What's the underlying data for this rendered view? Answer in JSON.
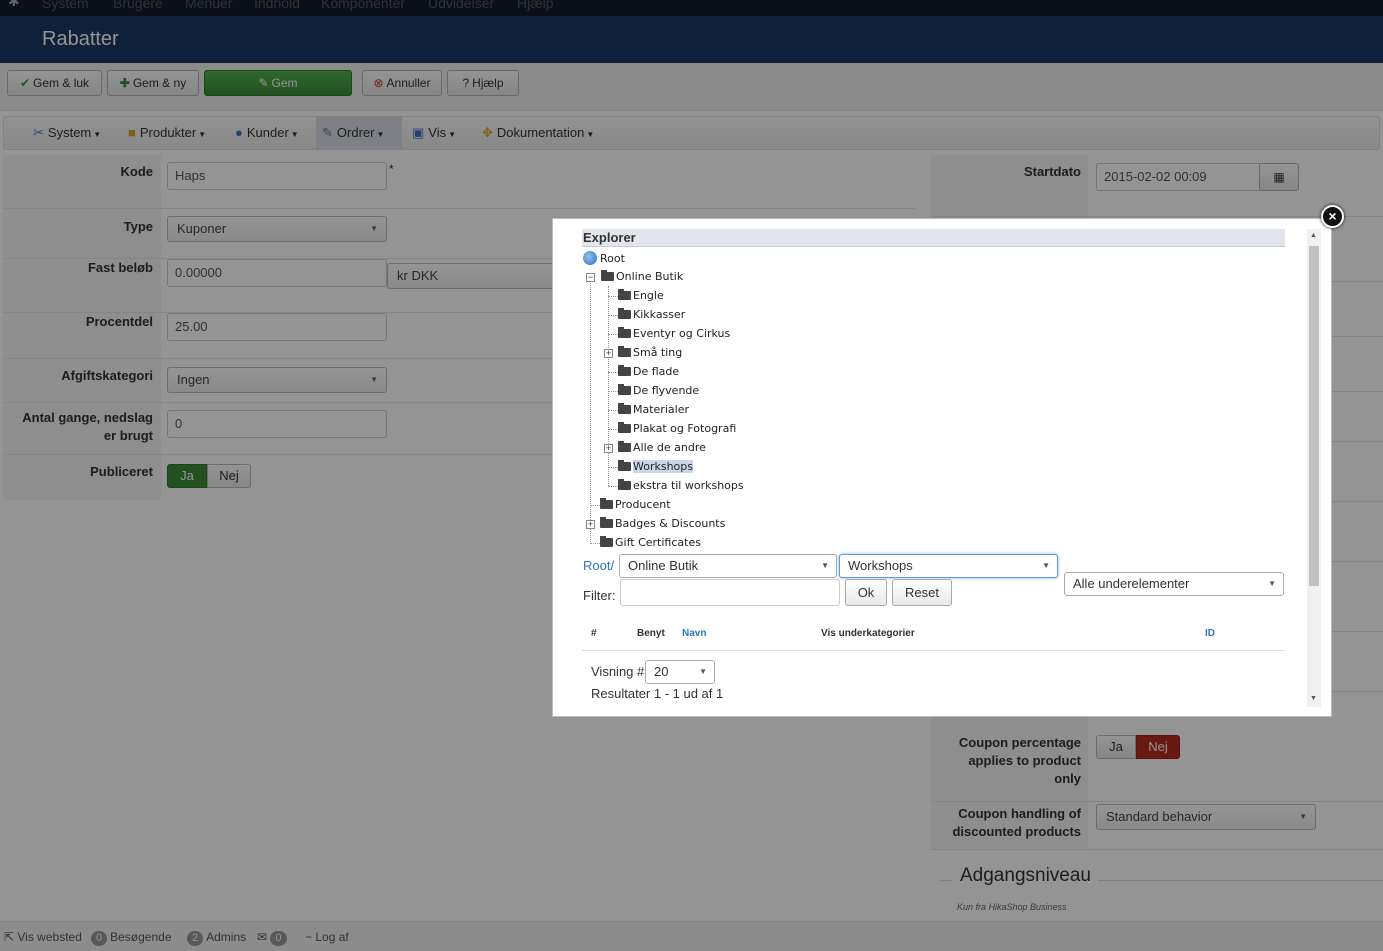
{
  "topnav": [
    "System",
    "Brugere",
    "Menuer",
    "Indhold",
    "Komponenter",
    "Udvidelser",
    "Hjælp"
  ],
  "page_title": "Rabatter",
  "toolbar": {
    "save_close": "Gem & luk",
    "save_new": "Gem & ny",
    "save": "Gem",
    "cancel": "Annuller",
    "help": "Hjælp"
  },
  "menubar": [
    {
      "label": "System",
      "icon": "tools-icon"
    },
    {
      "label": "Produkter",
      "icon": "box-icon"
    },
    {
      "label": "Kunder",
      "icon": "users-icon"
    },
    {
      "label": "Ordrer",
      "icon": "orders-icon"
    },
    {
      "label": "Vis",
      "icon": "display-icon"
    },
    {
      "label": "Dokumentation",
      "icon": "help-icon"
    }
  ],
  "form": {
    "code_label": "Kode",
    "code_value": "Haps",
    "required_mark": "*",
    "type_label": "Type",
    "type_value": "Kuponer",
    "fixed_label": "Fast beløb",
    "fixed_value": "0.00000",
    "currency_value": "kr DKK",
    "percent_label": "Procentdel",
    "percent_value": "25.00",
    "tax_label": "Afgiftskategori",
    "tax_value": "Ingen",
    "uses_label_1": "Antal gange, nedslag",
    "uses_label_2": "er brugt",
    "uses_value": "0",
    "published_label": "Publiceret",
    "yes": "Ja",
    "no": "Nej"
  },
  "right": {
    "start_label": "Startdato",
    "start_value": "2015-02-02 00:09",
    "coupon_pct_label_1": "Coupon percentage",
    "coupon_pct_label_2": "applies to product",
    "coupon_pct_label_3": "only",
    "coupon_yes": "Ja",
    "coupon_no": "Nej",
    "handling_label_1": "Coupon handling of",
    "handling_label_2": "discounted products",
    "handling_value": "Standard behavior",
    "access_heading": "Adgangsniveau",
    "access_note": "Kun fra HikaShop Business"
  },
  "modal": {
    "close": "×",
    "explorer_title": "Explorer",
    "tree": {
      "root": "Root",
      "online_butik": "Online Butik",
      "children": [
        "Engle",
        "Kikkasser",
        "Eventyr og Cirkus",
        "Små ting",
        "De flade",
        "De flyvende",
        "Materialer",
        "Plakat og Fotografi",
        "Alle de andre",
        "Workshops",
        "ekstra til workshops"
      ],
      "producent": "Producent",
      "badges": "Badges & Discounts",
      "gift": "Gift Certificates"
    },
    "breadcrumb_root": "Root/",
    "select1": "Online Butik",
    "select2": "Workshops",
    "select3": "Alle underelementer",
    "filter_label": "Filter:",
    "filter_value": "",
    "ok": "Ok",
    "reset": "Reset",
    "columns": {
      "num": "#",
      "use": "Benyt",
      "name": "Navn",
      "show_sub": "Vis underkategorier",
      "id": "ID"
    },
    "display_label": "Visning #",
    "display_value": "20",
    "results": "Resultater 1 - 1 ud af 1"
  },
  "statusbar": {
    "view_site": "Vis websted",
    "visitors_count": "0",
    "visitors": "Besøgende",
    "admins_count": "2",
    "admins": "Admins",
    "messages_count": "0",
    "logout": "Log af"
  }
}
